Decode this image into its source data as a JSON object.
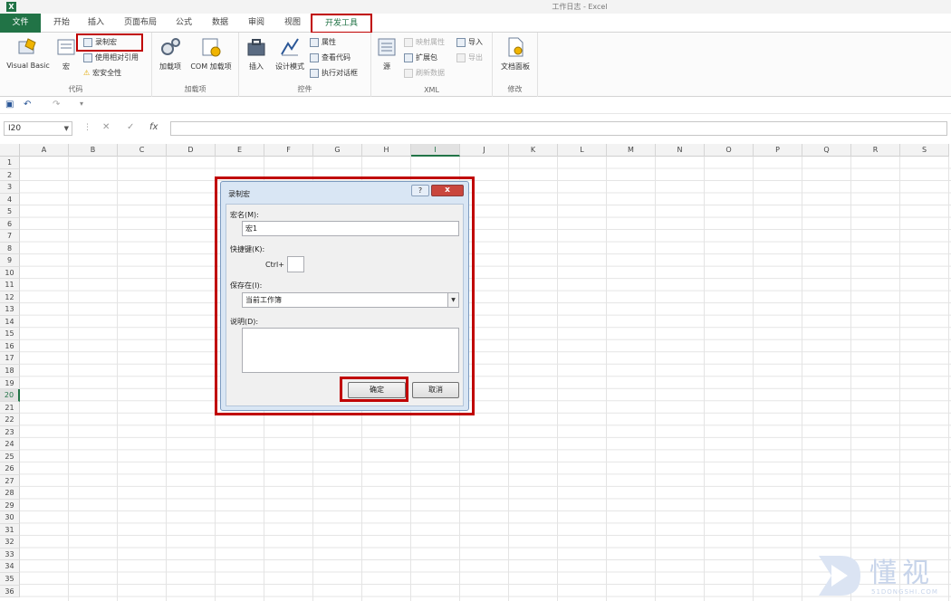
{
  "window": {
    "app_icon": "X",
    "title": "工作日志 - Excel"
  },
  "ribbon_tabs": [
    "文件",
    "开始",
    "插入",
    "页面布局",
    "公式",
    "数据",
    "审阅",
    "视图",
    "开发工具"
  ],
  "ribbon": {
    "code_group": {
      "label": "代码",
      "visual_basic": "Visual Basic",
      "macros": "宏",
      "record_macro": "录制宏",
      "use_relative_refs": "使用相对引用",
      "macro_security": "宏安全性"
    },
    "addins_group": {
      "label": "加载项",
      "addins": "加载项",
      "com_addins": "COM 加载项"
    },
    "controls_group": {
      "label": "控件",
      "insert": "插入",
      "design_mode": "设计模式",
      "properties": "属性",
      "view_code": "查看代码",
      "run_dialog": "执行对话框"
    },
    "xml_group": {
      "label": "XML",
      "source": "源",
      "map_properties": "映射属性",
      "expansion_packs": "扩展包",
      "refresh_data": "刷新数据",
      "import": "导入",
      "export": "导出"
    },
    "modify_group": {
      "label": "修改",
      "document_panel": "文档面板"
    }
  },
  "formula_bar": {
    "name_box": "I20",
    "fx": "fx"
  },
  "sheet": {
    "columns": [
      "A",
      "B",
      "C",
      "D",
      "E",
      "F",
      "G",
      "H",
      "I",
      "J",
      "K",
      "L",
      "M",
      "N",
      "O",
      "P",
      "Q",
      "R",
      "S"
    ],
    "selected_column": "I",
    "selected_row": 20,
    "row_count": 36
  },
  "dialog": {
    "title": "录制宏",
    "help": "?",
    "close": "x",
    "macro_name_label": "宏名(M):",
    "macro_name_value": "宏1",
    "shortcut_label": "快捷键(K):",
    "shortcut_prefix": "Ctrl+",
    "store_in_label": "保存在(I):",
    "store_in_value": "当前工作簿",
    "description_label": "说明(D):",
    "ok": "确定",
    "cancel": "取消"
  },
  "watermark": {
    "chars": "懂视",
    "sub": "51DONGSHI.COM"
  },
  "colors": {
    "excel_green": "#217346",
    "highlight_red": "#c00000"
  }
}
